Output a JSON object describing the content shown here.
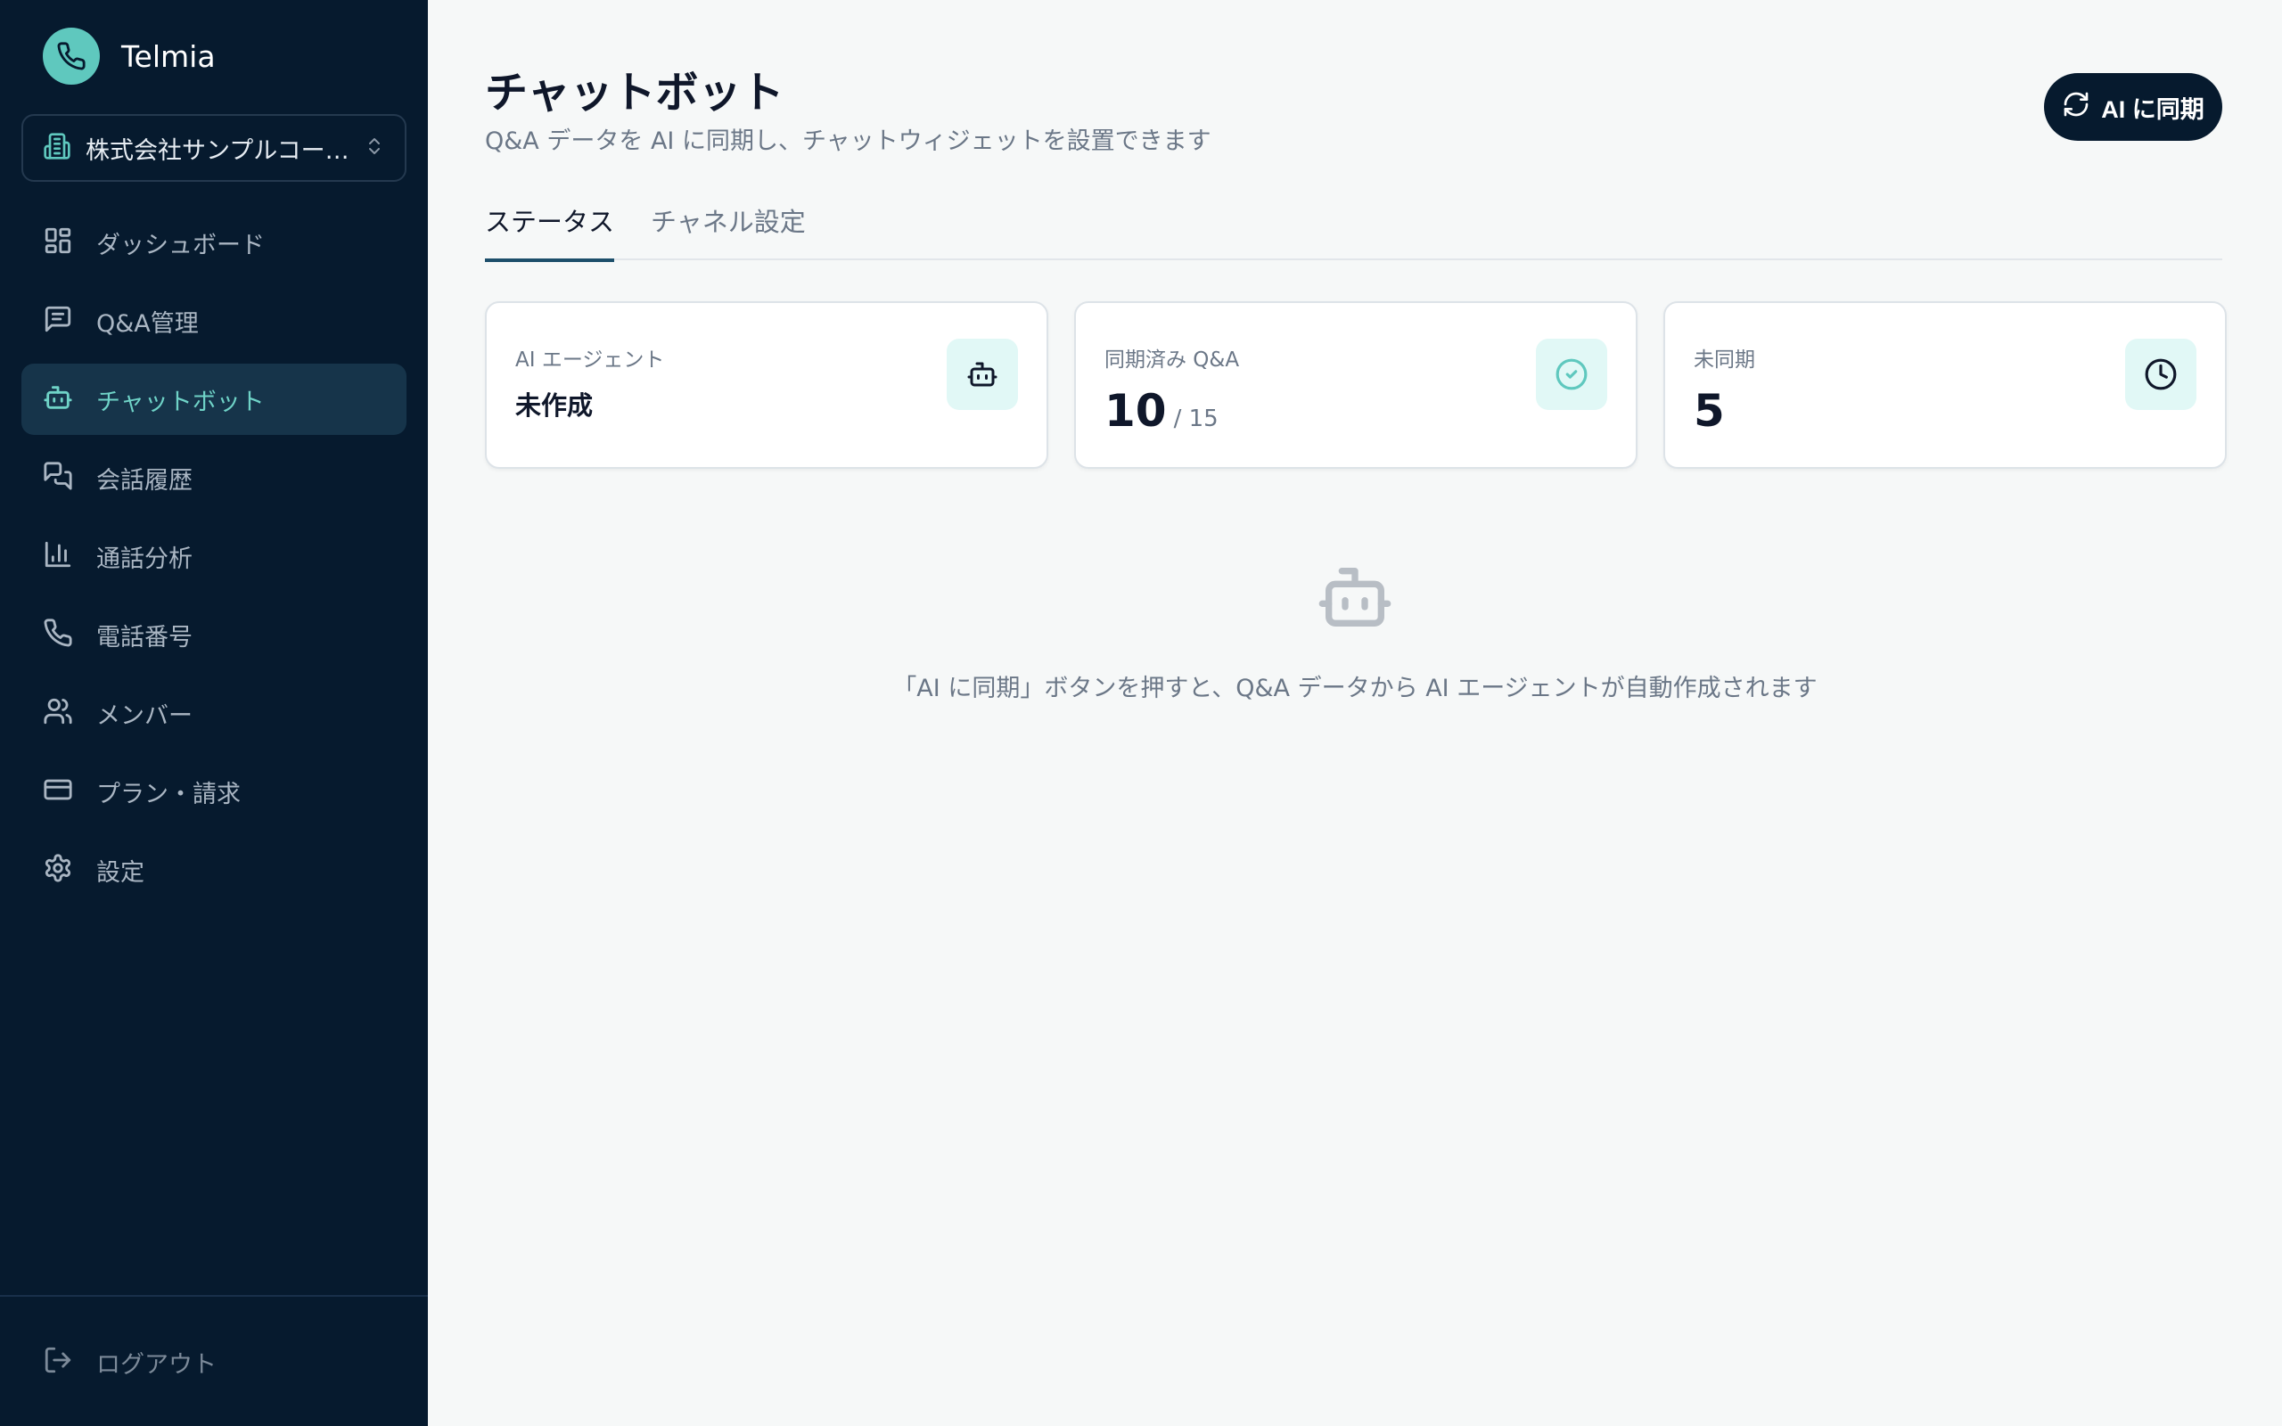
{
  "brand": {
    "name": "Telmia"
  },
  "org": {
    "name": "株式会社サンプルコーポレーション"
  },
  "nav": [
    {
      "label": "ダッシュボード",
      "icon": "dashboard-icon"
    },
    {
      "label": "Q&A管理",
      "icon": "message-square-icon"
    },
    {
      "label": "チャットボット",
      "icon": "bot-icon",
      "active": true
    },
    {
      "label": "会話履歴",
      "icon": "messages-icon"
    },
    {
      "label": "通話分析",
      "icon": "bar-chart-icon"
    },
    {
      "label": "電話番号",
      "icon": "phone-icon"
    },
    {
      "label": "メンバー",
      "icon": "users-icon"
    },
    {
      "label": "プラン・請求",
      "icon": "credit-card-icon"
    },
    {
      "label": "設定",
      "icon": "gear-icon"
    }
  ],
  "logout": {
    "label": "ログアウト"
  },
  "header": {
    "title": "チャットボット",
    "subtitle": "Q&A データを AI に同期し、チャットウィジェットを設置できます",
    "sync_label": "AI に同期"
  },
  "tabs": [
    {
      "label": "ステータス",
      "active": true
    },
    {
      "label": "チャネル設定"
    }
  ],
  "cards": [
    {
      "label": "AI エージェント",
      "value": "未作成",
      "icon": "bot-icon"
    },
    {
      "label": "同期済み Q&A",
      "value": "10",
      "sub": "/ 15",
      "icon": "check-circle-icon"
    },
    {
      "label": "未同期",
      "value": "5",
      "icon": "clock-icon"
    }
  ],
  "empty": {
    "message": "「AI に同期」ボタンを押すと、Q&A データから AI エージェントが自動作成されます",
    "icon": "bot-icon"
  },
  "colors": {
    "sidebar_bg": "#061a2e",
    "accent": "#5fc8be",
    "active_text": "#6fd3c7",
    "card_icon_bg": "#e1f8f6"
  }
}
